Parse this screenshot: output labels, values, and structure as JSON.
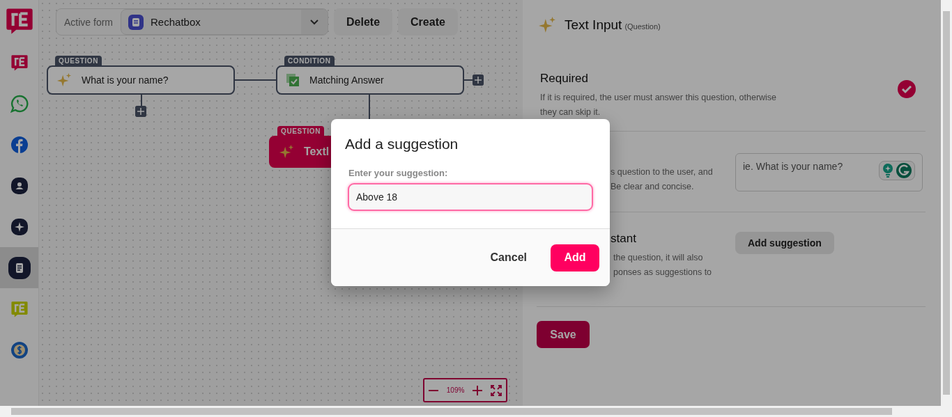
{
  "sidebar": {
    "items": [
      {
        "kind": "brand",
        "selected": false
      },
      {
        "kind": "whatsapp",
        "selected": false
      },
      {
        "kind": "facebook",
        "selected": false
      },
      {
        "kind": "person",
        "selected": false
      },
      {
        "kind": "sparkle",
        "selected": false
      },
      {
        "kind": "document",
        "selected": true
      },
      {
        "kind": "brand-alt",
        "selected": false
      },
      {
        "kind": "dollar",
        "selected": false
      }
    ]
  },
  "toolbar": {
    "active_form_label": "Active form",
    "form_value": "Rechatbox",
    "buttons": [
      "Delete",
      "Create"
    ]
  },
  "flow": {
    "nodes": [
      {
        "tag": "QUESTION",
        "kind": "question",
        "text": "What is your name?",
        "highlighted": false
      },
      {
        "tag": "CONDITION",
        "kind": "condition",
        "text": "Matching Answer",
        "highlighted": false
      },
      {
        "tag": "QUESTION",
        "kind": "question",
        "text": "Textl",
        "highlighted": true
      }
    ]
  },
  "zoom": {
    "level_text": "109%"
  },
  "panel": {
    "title": "Text Input",
    "subtitle": "(Question)",
    "sections": [
      {
        "kind": "toggle",
        "title": "Required",
        "description": "If it is required, the user must answer this question, otherwise they can skip it.",
        "checked": true
      },
      {
        "kind": "text",
        "description_fragments": [
          "s question to the user, and",
          "Be clear and concise."
        ],
        "placeholder": "ie. What is your name?"
      },
      {
        "kind": "suggestions",
        "title_fragment": "stant",
        "description_fragments": [
          "the question, it will also",
          "ponses as suggestions to"
        ],
        "button": "Add suggestion"
      }
    ],
    "save": "Save"
  },
  "modal": {
    "title": "Add a suggestion",
    "field_label": "Enter your suggestion:",
    "value": "Above 18",
    "cancel": "Cancel",
    "confirm": "Add"
  }
}
